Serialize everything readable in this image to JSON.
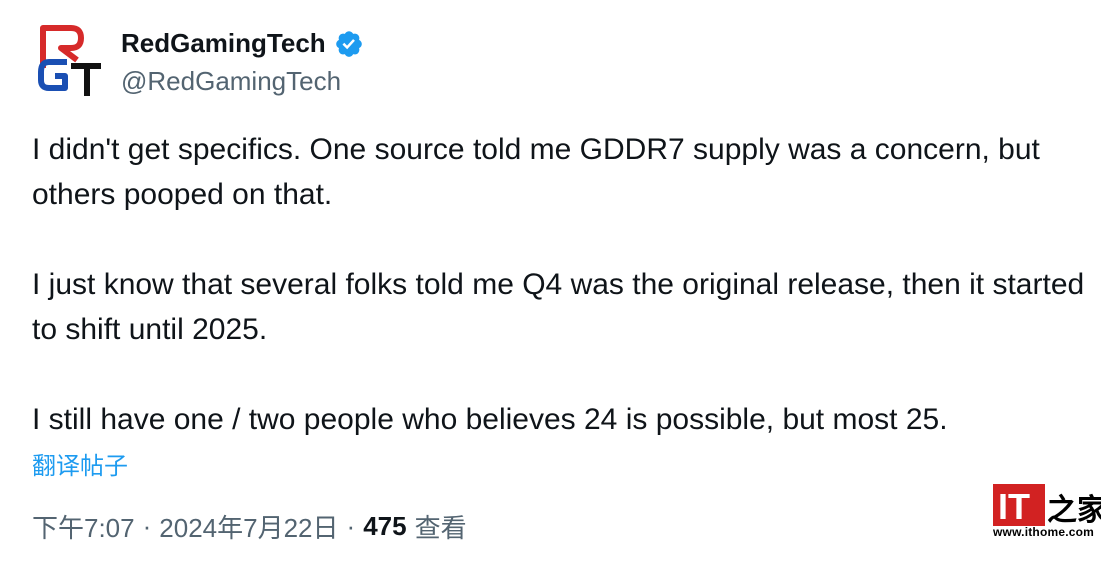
{
  "author": {
    "display_name": "RedGamingTech",
    "handle": "@RedGamingTech",
    "verified": true,
    "avatar_icon": "rgt-logo-avatar",
    "avatar_letters": "RGT"
  },
  "tweet": {
    "paragraphs": [
      "I didn't get specifics. One source told me GDDR7 supply was a concern, but others pooped on that.",
      "I just know that several folks told me Q4 was the original release, then it started to shift until 2025.",
      "I still have one / two people who believes 24 is possible, but most 25."
    ],
    "translate_label": "翻译帖子",
    "time": "下午7:07",
    "separator": "·",
    "date": "2024年7月22日",
    "views_count": "475",
    "views_label": "查看"
  },
  "watermark": {
    "logo_text": "IT之家",
    "url": "www.ithome.com"
  },
  "colors": {
    "text": "#0f1419",
    "secondary": "#536471",
    "link": "#1d9bf0",
    "verified_badge": "#1d9bf0",
    "watermark_red": "#d22222"
  }
}
